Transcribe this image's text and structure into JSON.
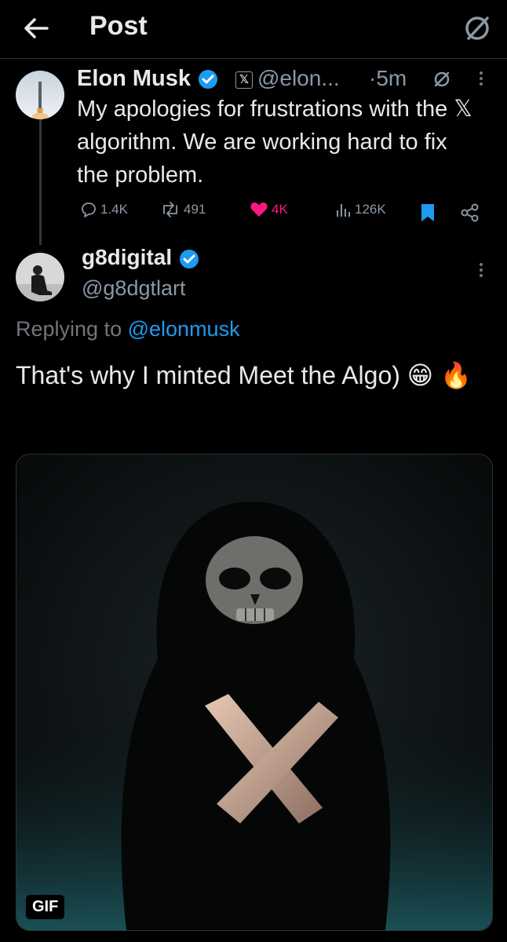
{
  "header": {
    "title": "Post",
    "back_icon": "arrow-left-icon",
    "action_icon": "circle-slash-icon"
  },
  "original_post": {
    "author_name": "Elon Musk",
    "handle": "@elon...",
    "time": "·5m",
    "text": "My apologies for frustrations with the 𝕏 algorithm. We are working hard to fix the problem.",
    "replies": "1.4K",
    "reposts": "491",
    "likes": "4K",
    "views": "126K"
  },
  "reply_post": {
    "author_name": "g8digital",
    "handle": "@g8dgtlart",
    "replying_to_prefix": "Replying to",
    "replying_to_handle": "@elonmusk",
    "text": "That's why I minted Meet the Algo) 😁 🔥",
    "media_badge": "GIF"
  },
  "colors": {
    "accent": "#1d9bf0",
    "like": "#f91880",
    "muted": "#8b98a5"
  }
}
